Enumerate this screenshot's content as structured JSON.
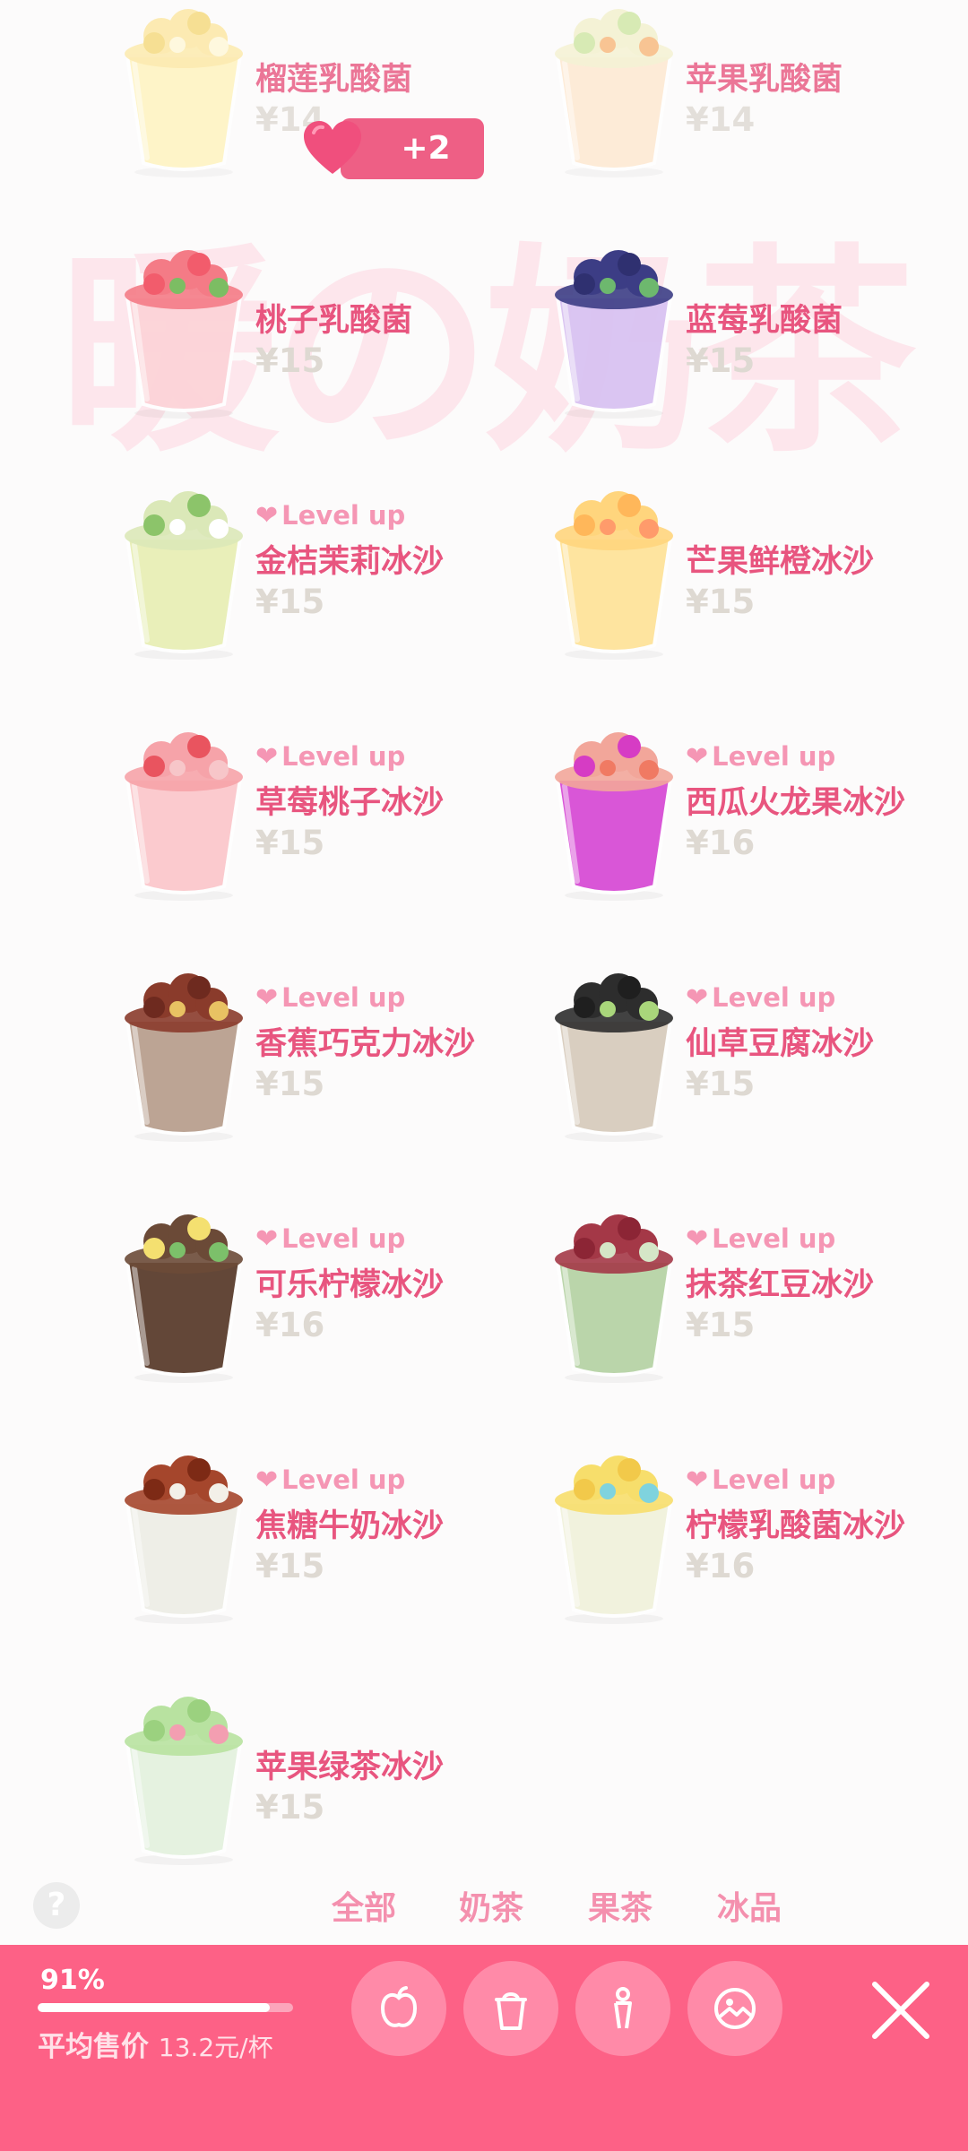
{
  "watermark": "暖の奶茶",
  "level_up_label": "Level up",
  "heart_pop": {
    "text": "+2"
  },
  "items": [
    {
      "name": "榴莲乳酸菌",
      "price": "¥14",
      "level_up": false,
      "theme": "durian"
    },
    {
      "name": "苹果乳酸菌",
      "price": "¥14",
      "level_up": false,
      "theme": "apple"
    },
    {
      "name": "桃子乳酸菌",
      "price": "¥15",
      "level_up": false,
      "theme": "peach"
    },
    {
      "name": "蓝莓乳酸菌",
      "price": "¥15",
      "level_up": false,
      "theme": "blueberry"
    },
    {
      "name": "金桔茉莉冰沙",
      "price": "¥15",
      "level_up": true,
      "theme": "kumquat"
    },
    {
      "name": "芒果鲜橙冰沙",
      "price": "¥15",
      "level_up": false,
      "theme": "mango"
    },
    {
      "name": "草莓桃子冰沙",
      "price": "¥15",
      "level_up": true,
      "theme": "strawberry"
    },
    {
      "name": "西瓜火龙果冰沙",
      "price": "¥16",
      "level_up": true,
      "theme": "dragonfruit"
    },
    {
      "name": "香蕉巧克力冰沙",
      "price": "¥15",
      "level_up": true,
      "theme": "banana-choco"
    },
    {
      "name": "仙草豆腐冰沙",
      "price": "¥15",
      "level_up": true,
      "theme": "grass-jelly"
    },
    {
      "name": "可乐柠檬冰沙",
      "price": "¥16",
      "level_up": true,
      "theme": "cola"
    },
    {
      "name": "抹茶红豆冰沙",
      "price": "¥15",
      "level_up": true,
      "theme": "matcha"
    },
    {
      "name": "焦糖牛奶冰沙",
      "price": "¥15",
      "level_up": true,
      "theme": "caramel"
    },
    {
      "name": "柠檬乳酸菌冰沙",
      "price": "¥16",
      "level_up": true,
      "theme": "lemon"
    },
    {
      "name": "苹果绿茶冰沙",
      "price": "¥15",
      "level_up": false,
      "theme": "green-apple"
    }
  ],
  "tabs": [
    "全部",
    "奶茶",
    "果茶",
    "冰品"
  ],
  "help_icon": "question-icon",
  "footer": {
    "progress_text": "91%",
    "progress": 0.91,
    "avg_label": "平均售价",
    "avg_value": "13.2元/杯",
    "buttons": [
      "apple-icon",
      "cup-icon",
      "person-icon",
      "image-icon"
    ],
    "close_icon": "close-icon"
  },
  "colors": {
    "accent": "#fd6186",
    "name": "#e8557f",
    "level": "#f596b4",
    "price": "#ded9d2"
  }
}
